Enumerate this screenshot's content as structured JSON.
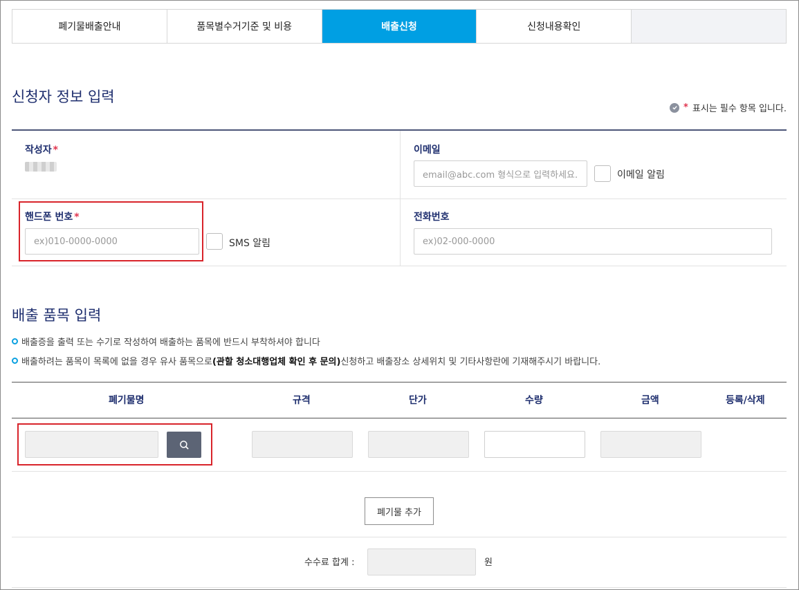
{
  "tabs": [
    {
      "label": "폐기물배출안내",
      "active": false
    },
    {
      "label": "품목별수거기준 및 비용",
      "active": false
    },
    {
      "label": "배출신청",
      "active": true
    },
    {
      "label": "신청내용확인",
      "active": false
    },
    {
      "label": "",
      "active": false
    }
  ],
  "applicant": {
    "title": "신청자 정보 입력",
    "required_note": "표시는 필수 항목 입니다.",
    "required_mark": "*",
    "author_label": "작성자",
    "email_label": "이메일",
    "email_placeholder": "email@abc.com 형식으로 입력하세요.",
    "email_notify_label": "이메일 알림",
    "phone_label": "핸드폰 번호",
    "phone_placeholder": "ex)010-0000-0000",
    "sms_notify_label": "SMS 알림",
    "tel_label": "전화번호",
    "tel_placeholder": "ex)02-000-0000"
  },
  "items": {
    "title": "배출 품목 입력",
    "bullet1": "배출증을 출력 또는 수기로 작성하여 배출하는 품목에 반드시 부착하셔야 합니다",
    "bullet2_pre": "배출하려는 품목이 목록에 없을 경우 유사 품목으로",
    "bullet2_bold": "(관할 청소대행업체 확인 후 문의)",
    "bullet2_post": " 신청하고 배출장소 상세위치 및 기타사항란에 기재해주시기 바랍니다.",
    "columns": [
      "폐기물명",
      "규격",
      "단가",
      "수량",
      "금액",
      "등록/삭제"
    ],
    "add_button": "폐기물 추가",
    "fee_total_label": "수수료 합계 :",
    "currency": "원"
  },
  "colors": {
    "accent": "#009fe3",
    "title": "#1e2e6e",
    "required": "#e0334d",
    "highlight_box": "#d8232a"
  }
}
